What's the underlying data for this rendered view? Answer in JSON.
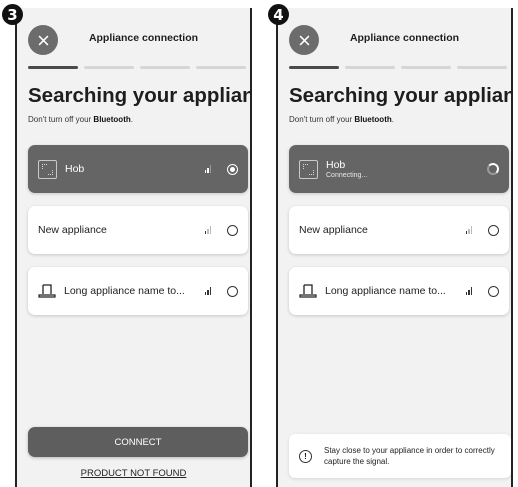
{
  "steps": [
    "3",
    "4"
  ],
  "header": {
    "title": "Appliance connection",
    "close_icon": "close-icon"
  },
  "progress": {
    "total_steps": 4,
    "current_step": 1
  },
  "heading": "Searching your appliance",
  "subtitle": {
    "prefix": "Don't turn off your ",
    "bold": "Bluetooth",
    "suffix": "."
  },
  "screen3": {
    "appliances": [
      {
        "name": "Hob",
        "icon": "hob-icon",
        "signal_bars": 2,
        "selected": true
      },
      {
        "name": "New appliance",
        "icon": "",
        "signal_bars": 1,
        "selected": false
      },
      {
        "name": "Long appliance name to...",
        "icon": "oven-icon",
        "signal_bars": 3,
        "selected": false
      }
    ],
    "connect_label": "CONNECT",
    "not_found_label": "PRODUCT NOT FOUND"
  },
  "screen4": {
    "appliances": [
      {
        "name": "Hob",
        "status": "Connecting...",
        "icon": "hob-icon",
        "selected": true,
        "connecting": true
      },
      {
        "name": "New appliance",
        "icon": "",
        "signal_bars": 1,
        "selected": false
      },
      {
        "name": "Long appliance name to...",
        "icon": "oven-icon",
        "signal_bars": 3,
        "selected": false
      }
    ],
    "info_text": "Stay close to your appliance in order to correctly capture the signal."
  },
  "colors": {
    "selected_card": "#656565",
    "button": "#5e5e5e",
    "background": "#f2f2f2"
  }
}
